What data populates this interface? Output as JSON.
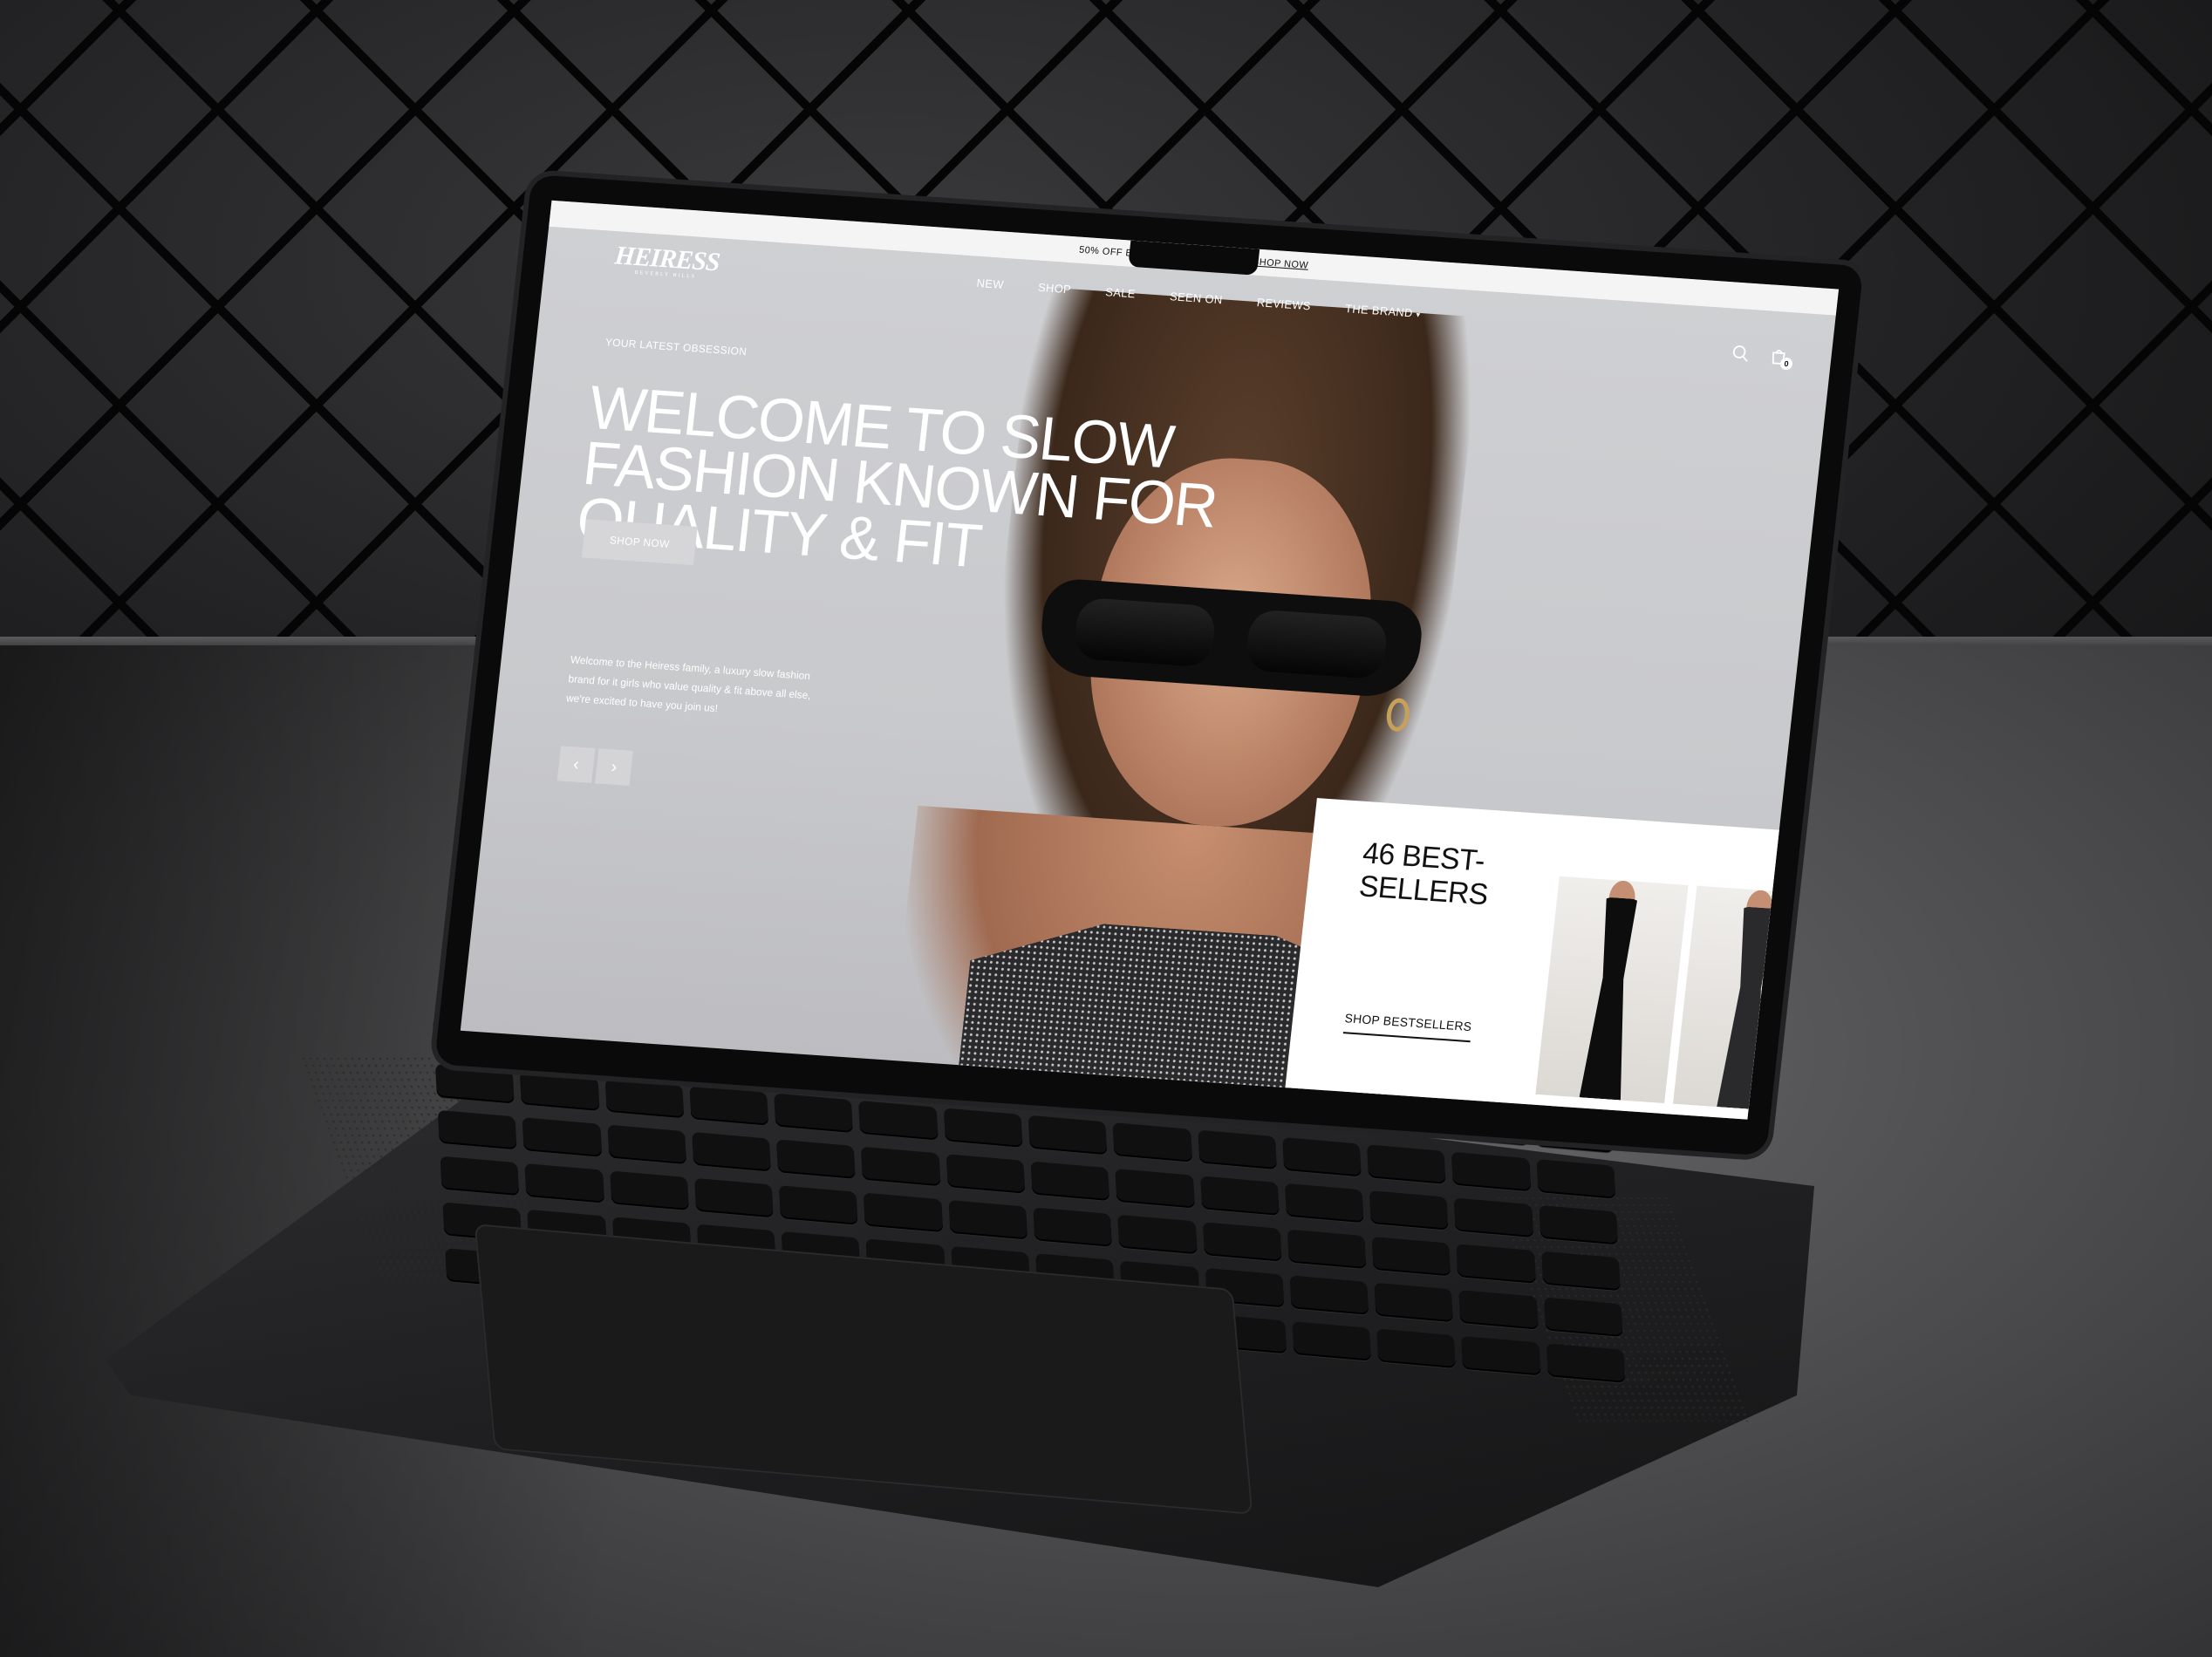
{
  "announcement": {
    "text": "50% OFF E",
    "link": "SHOP NOW"
  },
  "logo": {
    "brand": "HEIRESS",
    "tagline": "BEVERLY HILLS"
  },
  "nav": {
    "items": [
      {
        "label": "NEW"
      },
      {
        "label": "SHOP"
      },
      {
        "label": "SALE"
      },
      {
        "label": "SEEN ON"
      },
      {
        "label": "REVIEWS"
      },
      {
        "label": "THE BRAND",
        "has_dropdown": true
      }
    ]
  },
  "header_icons": {
    "search": "search-icon",
    "cart": "shopping-bag-icon",
    "cart_count": "0"
  },
  "hero": {
    "kicker": "YOUR LATEST OBSESSION",
    "headline": "WELCOME TO SLOW FASHION KNOWN FOR QUALITY & FIT",
    "cta": "SHOP NOW",
    "intro": "Welcome to the Heiress family, a luxury slow fashion brand for it girls who value quality & fit above all else, we're excited to have you join us!",
    "prev": "‹",
    "next": "›"
  },
  "bestsellers": {
    "title": "46 BEST-SELLERS",
    "link": "SHOP BESTSELLERS"
  },
  "colors": {
    "accent": "#ffffff",
    "text_dark": "#111111",
    "hero_bg": "#c9cacd"
  }
}
